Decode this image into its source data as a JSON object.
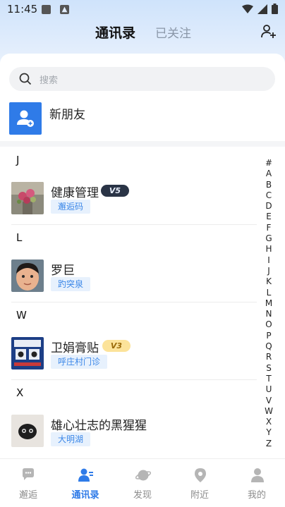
{
  "status_bar": {
    "time": "11:45"
  },
  "header": {
    "tabs": [
      {
        "label": "通讯录"
      },
      {
        "label": "已关注"
      }
    ]
  },
  "search": {
    "placeholder": "搜索"
  },
  "new_friend": {
    "label": "新朋友"
  },
  "sections": [
    {
      "letter": "J",
      "contacts": [
        {
          "name": "健康管理",
          "tag": "邂逅码",
          "badge": "V5"
        }
      ]
    },
    {
      "letter": "L",
      "contacts": [
        {
          "name": "罗巨",
          "tag": "趵突泉",
          "badge": ""
        }
      ]
    },
    {
      "letter": "W",
      "contacts": [
        {
          "name": "卫娟膏贴",
          "tag": "呼庄村门诊",
          "badge": "V3"
        }
      ]
    },
    {
      "letter": "X",
      "contacts": [
        {
          "name": "雄心壮志的黑猩猩",
          "tag": "大明湖",
          "badge": ""
        }
      ]
    }
  ],
  "index_letters": [
    "#",
    "A",
    "B",
    "C",
    "D",
    "E",
    "F",
    "G",
    "H",
    "I",
    "J",
    "K",
    "L",
    "M",
    "N",
    "O",
    "P",
    "Q",
    "R",
    "S",
    "T",
    "U",
    "V",
    "W",
    "X",
    "Y",
    "Z"
  ],
  "bottom_nav": [
    {
      "label": "邂逅",
      "icon": "chat-icon",
      "active": false
    },
    {
      "label": "通讯录",
      "icon": "contacts-icon",
      "active": true
    },
    {
      "label": "发现",
      "icon": "planet-icon",
      "active": false
    },
    {
      "label": "附近",
      "icon": "location-icon",
      "active": false
    },
    {
      "label": "我的",
      "icon": "profile-icon",
      "active": false
    }
  ],
  "colors": {
    "accent": "#2f7be8",
    "tag_bg": "#e7f1fd",
    "tag_text": "#3b87e8"
  }
}
